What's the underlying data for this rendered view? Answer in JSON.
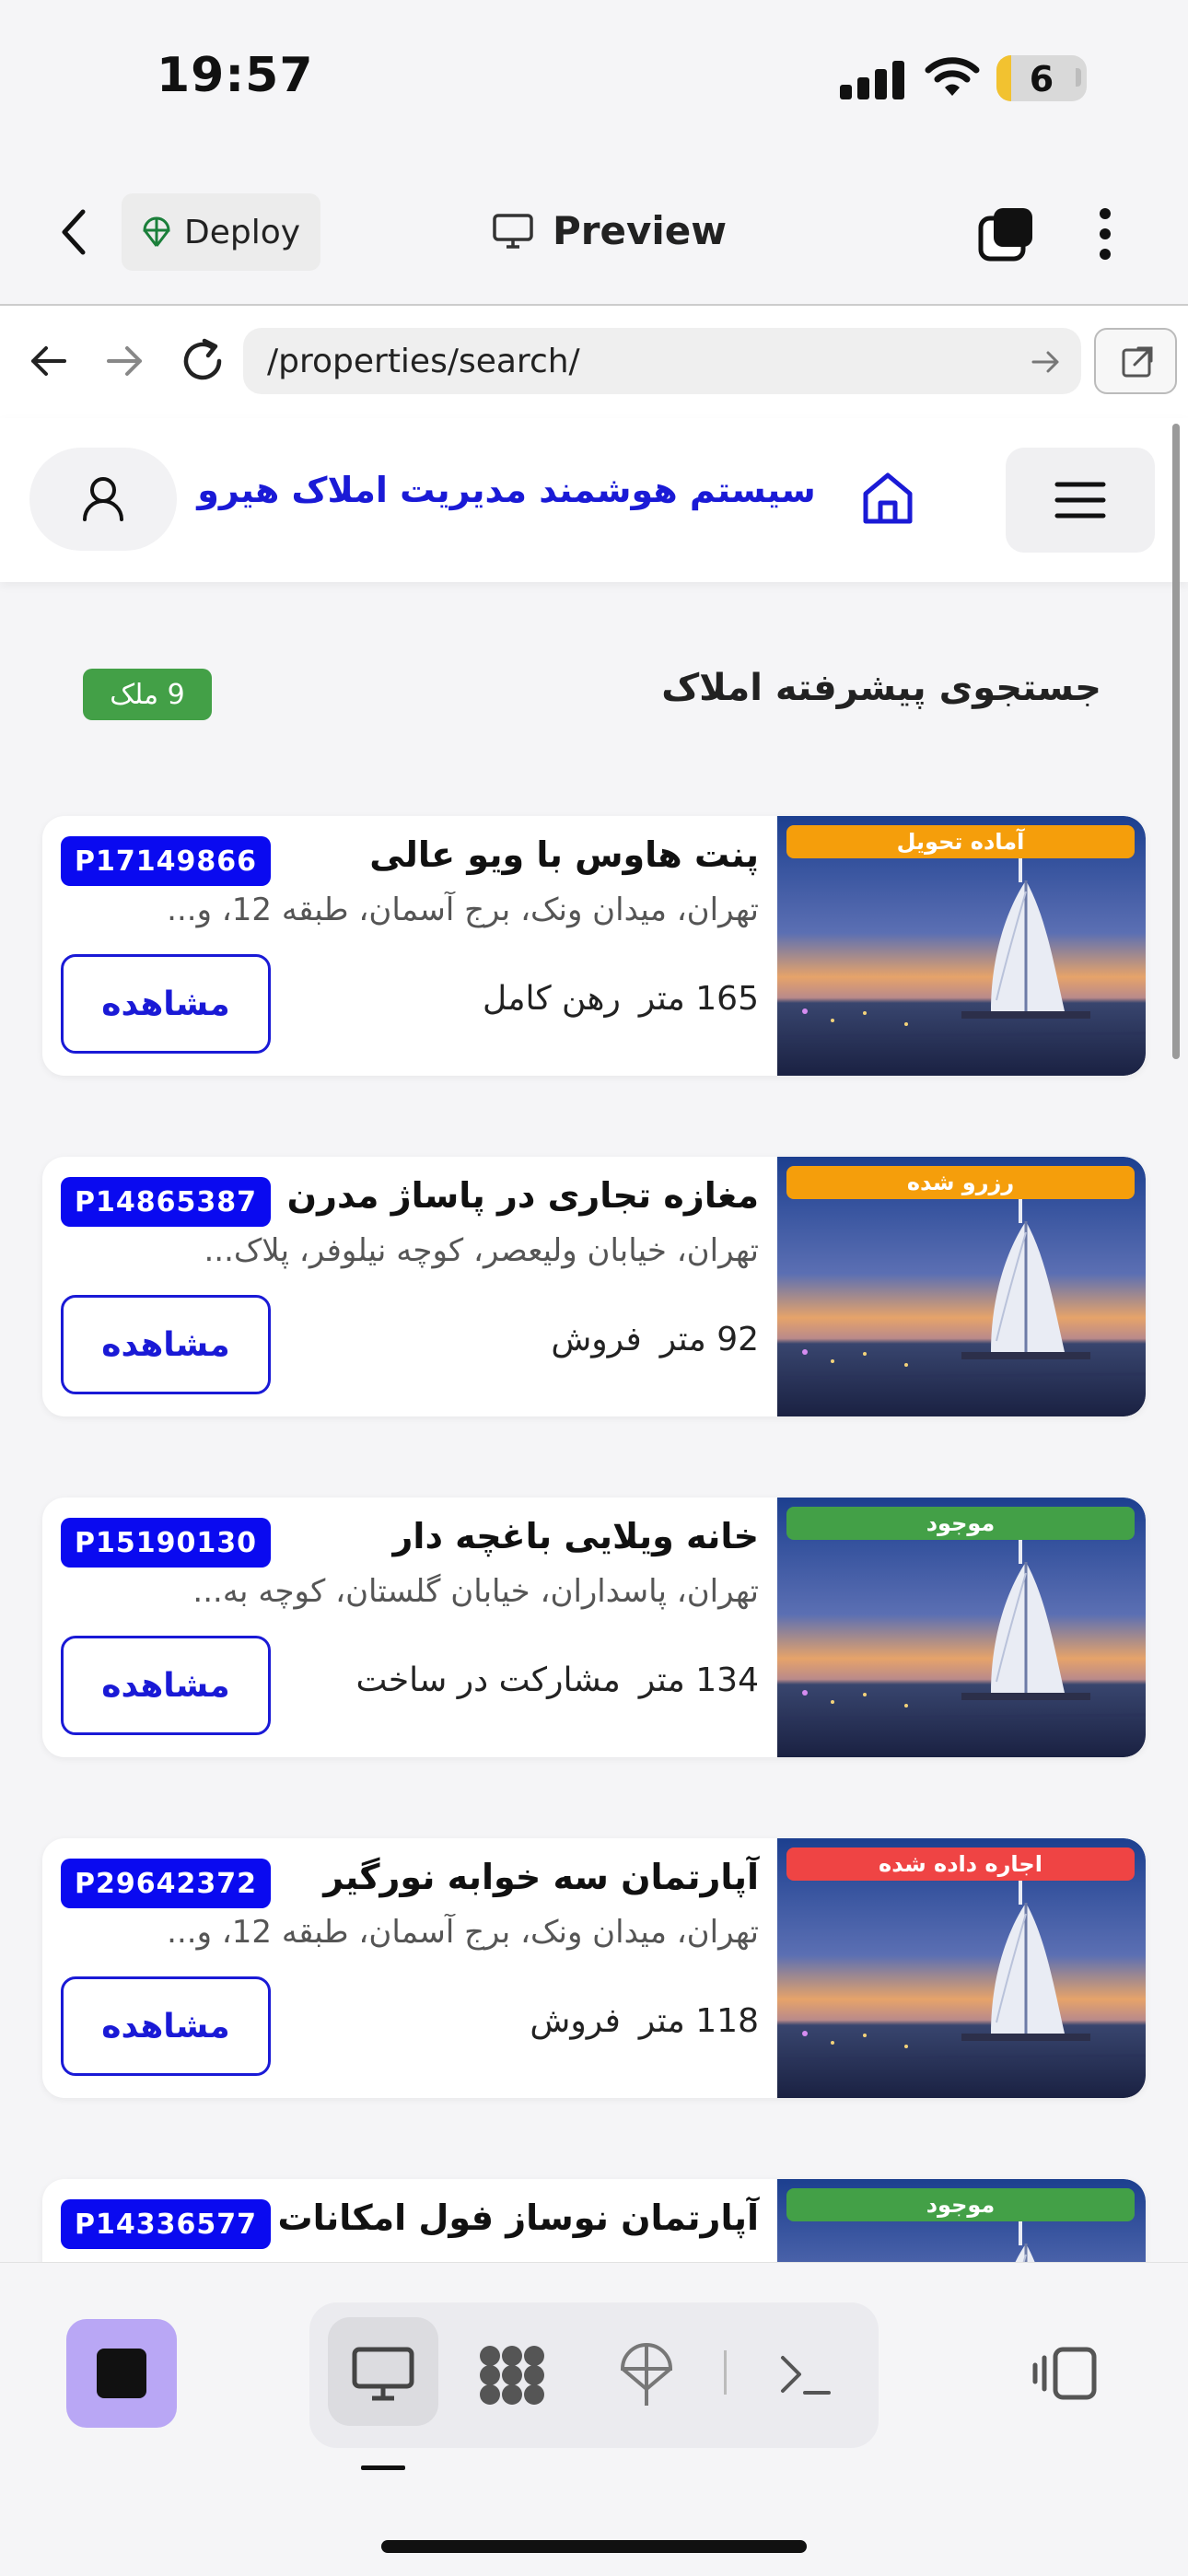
{
  "status_bar": {
    "time": "19:57",
    "battery": "6"
  },
  "toolbar": {
    "deploy_label": "Deploy",
    "preview_label": "Preview"
  },
  "browser": {
    "url": "/properties/search/"
  },
  "site": {
    "title": "سیستم هوشمند مدیریت املاک هیرو"
  },
  "results": {
    "title": "جستجوی پیشرفته املاک",
    "count": "9 ملک"
  },
  "view_label": "مشاهده",
  "colors": {
    "accent": "#1a1ad6",
    "code_badge": "#0a0af0",
    "available": "#43a047",
    "orange": "#f59e0b",
    "red": "#ef4444"
  },
  "listings": [
    {
      "name": "پنت هاوس با ویو عالی",
      "address": "تهران، میدان ونک، برج آسمان، طبقه 12، و...",
      "area": "165 متر",
      "deal": "رهن کامل",
      "code": "P17149866",
      "status": "آماده تحویل",
      "status_color": "#f59e0b"
    },
    {
      "name": "مغازه تجاری در پاساژ مدرن",
      "address": "تهران، خیابان ولیعصر، کوچه نیلوفر، پلاک...",
      "area": "92 متر",
      "deal": "فروش",
      "code": "P14865387",
      "status": "رزرو شده",
      "status_color": "#f59e0b"
    },
    {
      "name": "خانه ویلایی باغچه دار",
      "address": "تهران، پاسداران، خیابان گلستان، کوچه به...",
      "area": "134 متر",
      "deal": "مشارکت در ساخت",
      "code": "P15190130",
      "status": "موجود",
      "status_color": "#43a047"
    },
    {
      "name": "آپارتمان سه خوابه نورگیر",
      "address": "تهران، میدان ونک، برج آسمان، طبقه 12، و...",
      "area": "118 متر",
      "deal": "فروش",
      "code": "P29642372",
      "status": "اجاره داده شده",
      "status_color": "#ef4444"
    },
    {
      "name": "آپارتمان نوساز فول امکانات",
      "address": "",
      "area": "",
      "deal": "",
      "code": "P14336577",
      "status": "موجود",
      "status_color": "#43a047"
    }
  ]
}
